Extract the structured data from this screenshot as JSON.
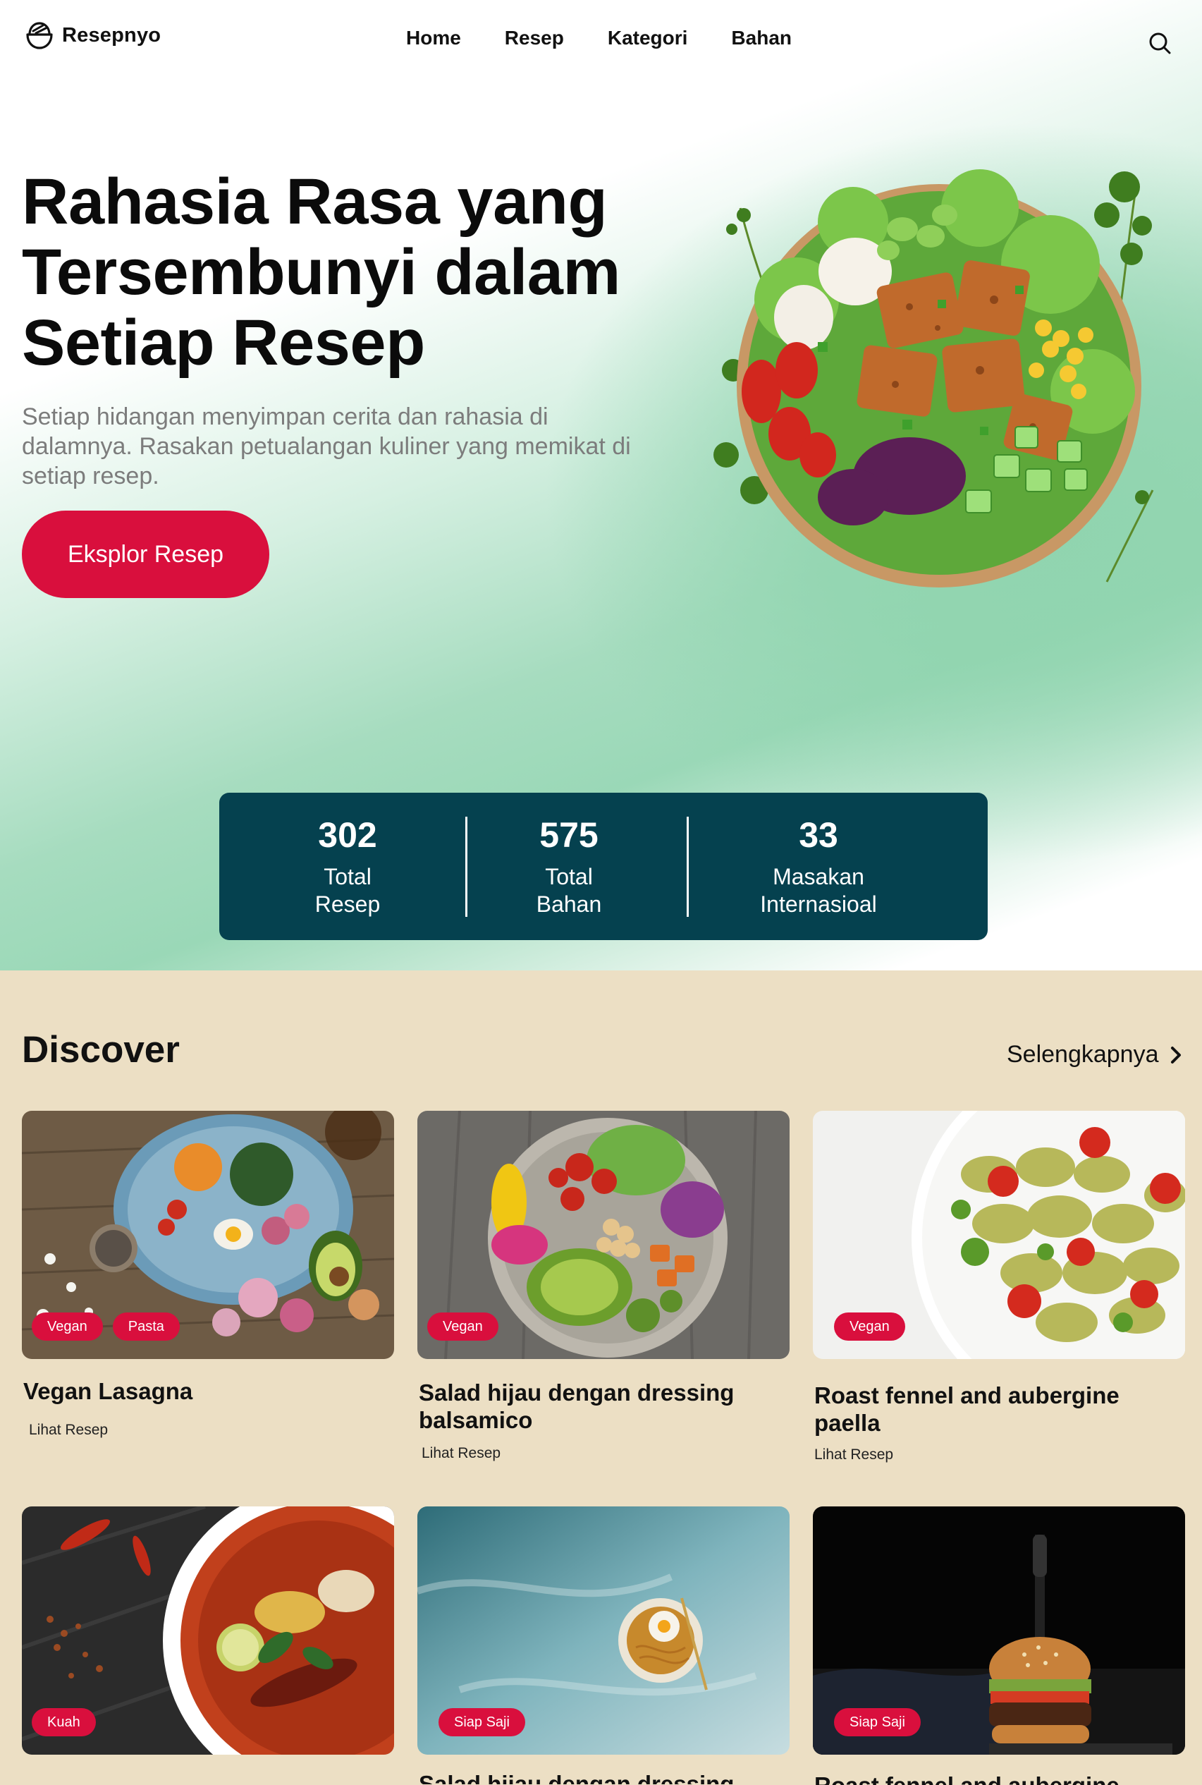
{
  "nav": {
    "brand": "Resepnyo",
    "links": [
      "Home",
      "Resep",
      "Kategori",
      "Bahan"
    ],
    "search_icon": "search-icon",
    "logo_icon": "bowl-logo-icon"
  },
  "hero": {
    "title": "Rahasia Rasa yang Tersembunyi dalam Setiap Resep",
    "subtitle": "Setiap hidangan menyimpan cerita dan rahasia di dalamnya. Rasakan petualangan kuliner yang memikat di setiap resep.",
    "cta": "Eksplor Resep"
  },
  "stats": [
    {
      "value": "302",
      "label_line1": "Total",
      "label_line2": "Resep"
    },
    {
      "value": "575",
      "label_line1": "Total",
      "label_line2": "Bahan"
    },
    {
      "value": "33",
      "label_line1": "Masakan",
      "label_line2": "Internasioal"
    }
  ],
  "discover": {
    "title": "Discover",
    "more": "Selengkapnya",
    "cards": [
      {
        "title": "Vegan Lasagna",
        "tags": [
          "Vegan",
          "Pasta"
        ],
        "link": "Lihat Resep"
      },
      {
        "title": "Salad hijau dengan dressing balsamico",
        "tags": [
          "Vegan"
        ],
        "link": "Lihat Resep"
      },
      {
        "title": "Roast fennel and aubergine paella",
        "tags": [
          "Vegan"
        ],
        "link": "Lihat Resep"
      },
      {
        "title": "",
        "tags": [
          "Kuah"
        ],
        "link": ""
      },
      {
        "title": "Salad hijau dengan dressing",
        "tags": [
          "Siap Saji"
        ],
        "link": ""
      },
      {
        "title": "Roast fennel and aubergine",
        "tags": [
          "Siap Saji"
        ],
        "link": ""
      }
    ]
  },
  "colors": {
    "accent": "#d90f3d",
    "stats_bg": "#05414f",
    "discover_bg": "#ecdfc4",
    "hero_green": "#8fd4ae"
  }
}
